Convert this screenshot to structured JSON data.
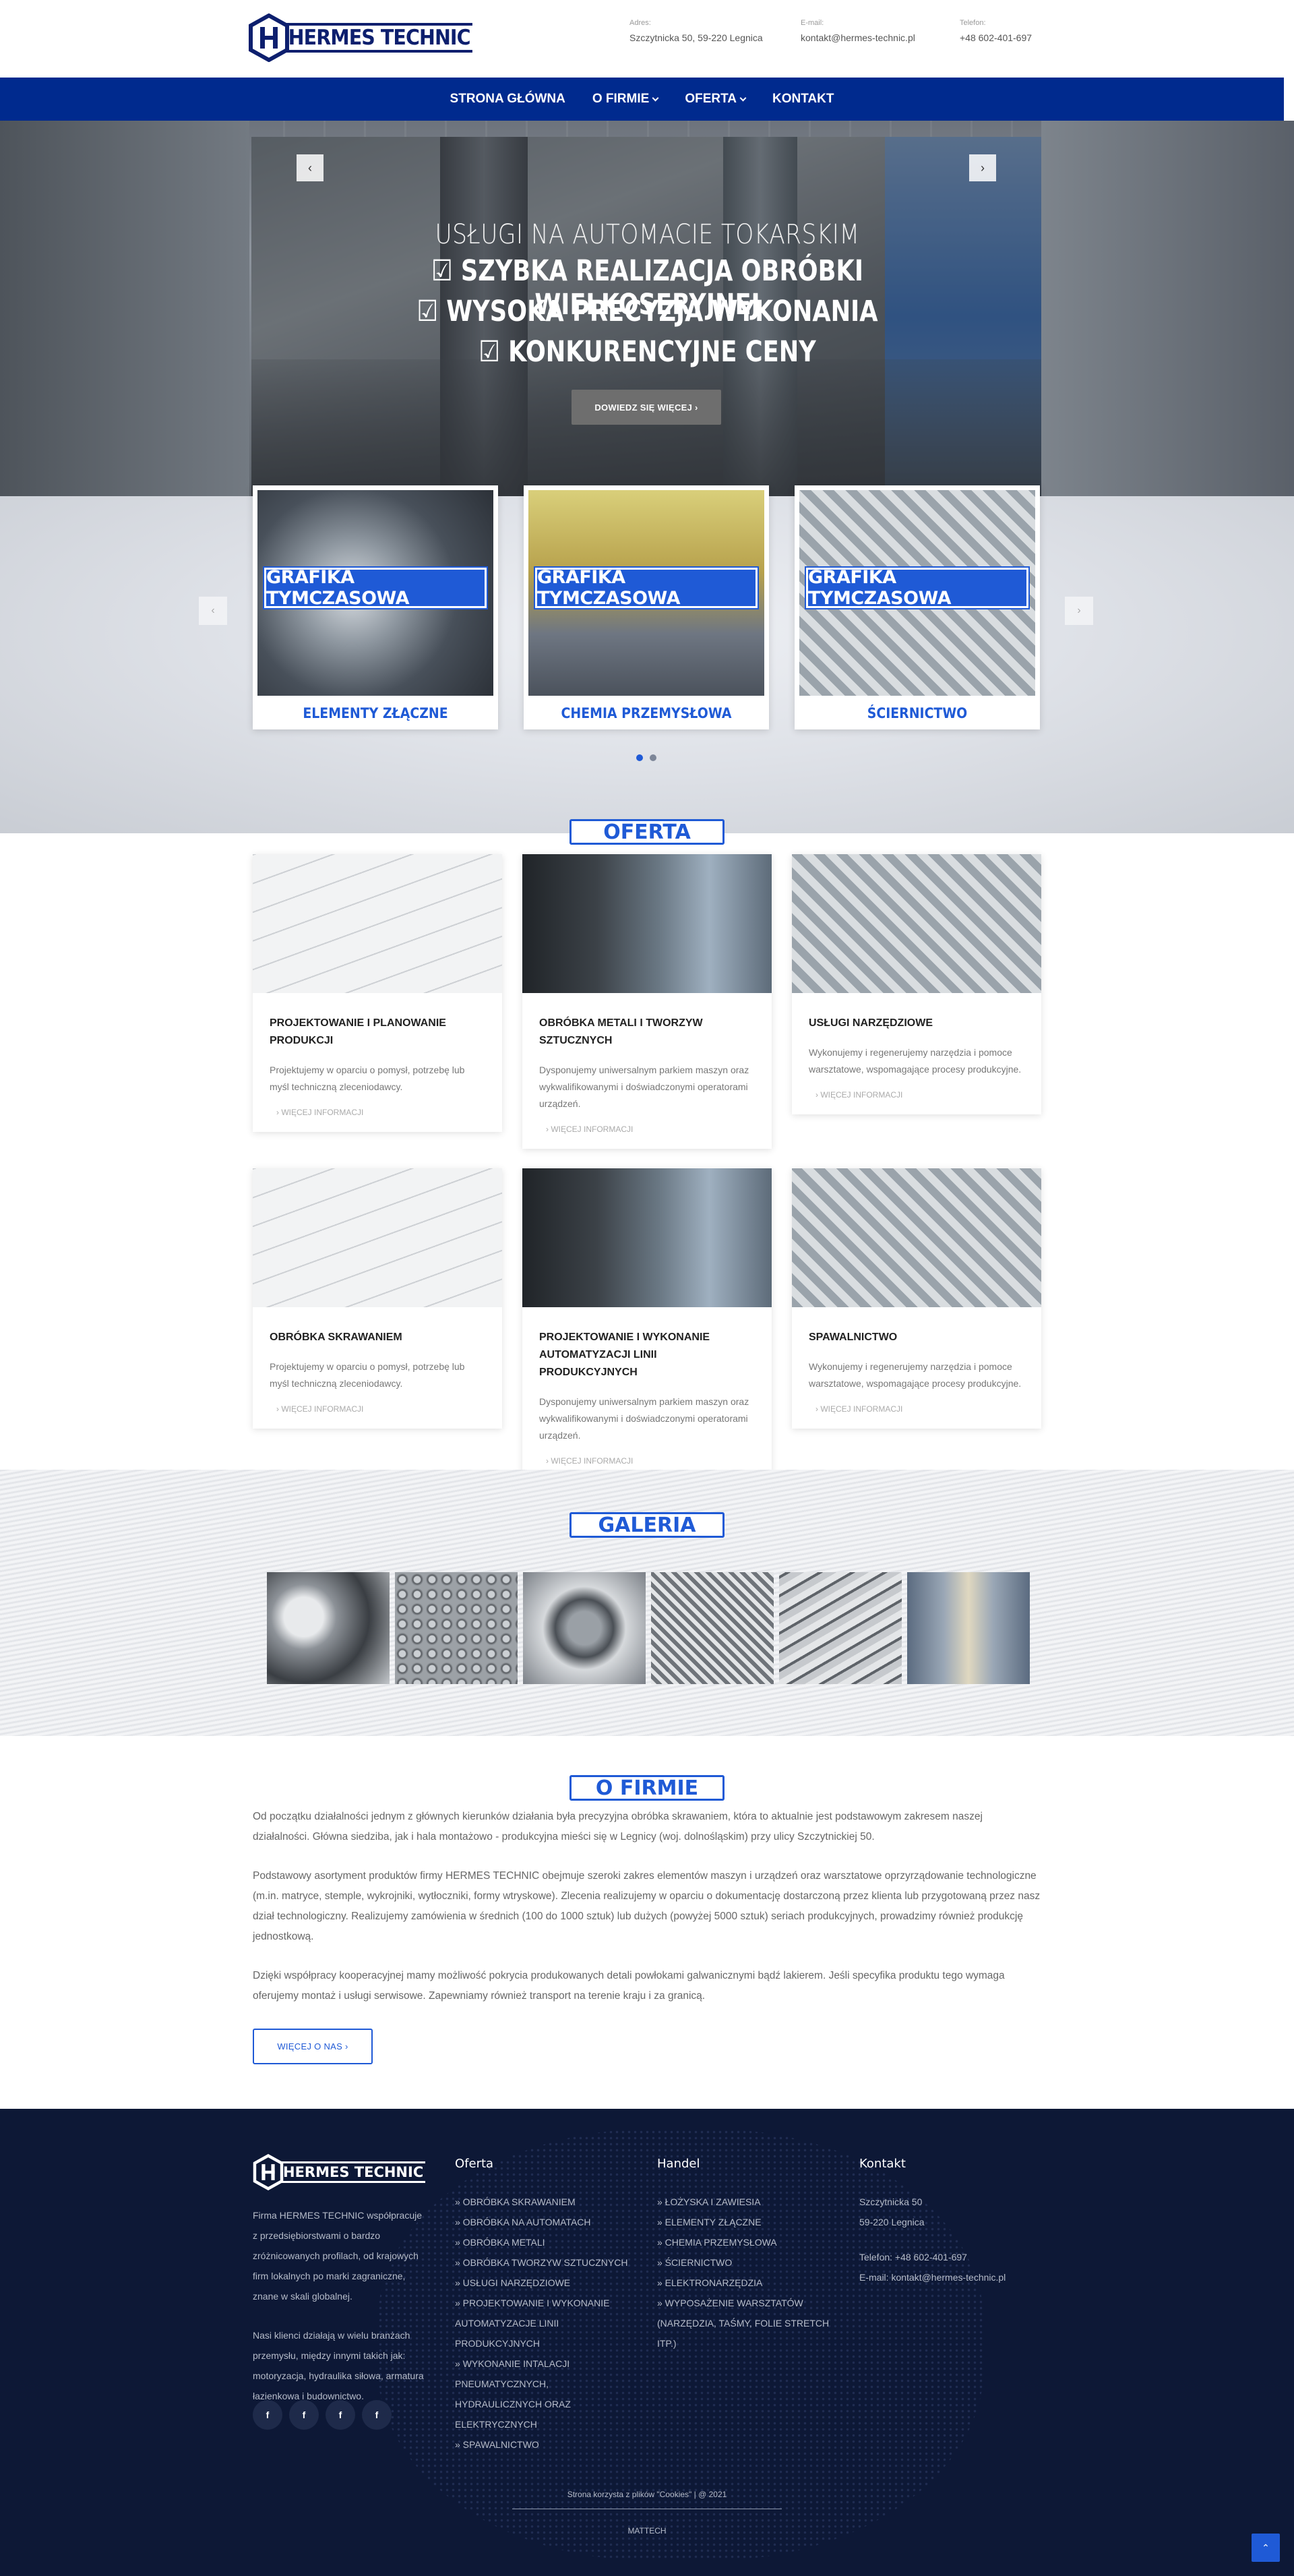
{
  "header": {
    "logo_text": "HERMES TECHNIC",
    "address_label": "Adres:",
    "address": "Szczytnicka 50, 59-220 Legnica",
    "email_label": "E-mail:",
    "email": "kontakt@hermes-technic.pl",
    "phone_label": "Telefon:",
    "phone": "+48 602-401-697"
  },
  "nav": {
    "home": "STRONA GŁÓWNA",
    "about": "O FIRMIE",
    "offer": "OFERTA",
    "contact": "KONTAKT"
  },
  "hero": {
    "subtitle": "USŁUGI NA AUTOMACIE TOKARSKIM",
    "line1": "☑ SZYBKA REALIZACJA OBRÓBKI WIELKOSERYJNEJ",
    "line2": "☑ WYSOKA PRECYZJA WYKONANIA",
    "line3": "☑ KONKURENCYJNE CENY",
    "button": "DOWIEDZ SIĘ WIĘCEJ  ›"
  },
  "categories": [
    {
      "banner": "GRAFIKA TYMCZASOWA",
      "label": "ELEMENTY ZŁĄCZNE"
    },
    {
      "banner": "GRAFIKA TYMCZASOWA",
      "label": "CHEMIA PRZEMYSŁOWA"
    },
    {
      "banner": "GRAFIKA TYMCZASOWA",
      "label": "ŚCIERNICTWO"
    }
  ],
  "offer_title": "OFERTA",
  "offers": [
    {
      "title": "PROJEKTOWANIE I PLANOWANIE PRODUKCJI",
      "desc": "Projektujemy w oparciu o pomysł, potrzebę lub myśl techniczną zleceniodawcy.",
      "more": "›  WIĘCEJ INFORMACJI"
    },
    {
      "title": "OBRÓBKA METALI I TWORZYW SZTUCZNYCH",
      "desc": "Dysponujemy uniwersalnym parkiem maszyn oraz wykwalifikowanymi i doświadczonymi operatorami urządzeń.",
      "more": "›  WIĘCEJ INFORMACJI"
    },
    {
      "title": "USŁUGI NARZĘDZIOWE",
      "desc": "Wykonujemy i regenerujemy narzędzia i pomoce warsztatowe, wspomagające procesy produkcyjne.",
      "more": "›  WIĘCEJ INFORMACJI"
    },
    {
      "title": "OBRÓBKA SKRAWANIEM",
      "desc": "Projektujemy w oparciu o pomysł, potrzebę lub myśl techniczną zleceniodawcy.",
      "more": "›  WIĘCEJ INFORMACJI"
    },
    {
      "title": "PROJEKTOWANIE I WYKONANIE AUTOMATYZACJI LINII PRODUKCYJNYCH",
      "desc": "Dysponujemy uniwersalnym parkiem maszyn oraz wykwalifikowanymi i doświadczonymi operatorami urządzeń.",
      "more": "›  WIĘCEJ INFORMACJI"
    },
    {
      "title": "SPAWALNICTWO",
      "desc": "Wykonujemy i regenerujemy narzędzia i pomoce warsztatowe, wspomagające procesy produkcyjne.",
      "more": "›  WIĘCEJ INFORMACJI"
    }
  ],
  "gallery_title": "GALERIA",
  "about": {
    "title": "O FIRMIE",
    "p1": "Od początku działalności jednym z głównych kierunków działania była precyzyjna obróbka skrawaniem, która to aktualnie jest podstawowym zakresem naszej działalności. Główna siedziba, jak i hala montażowo - produkcyjna mieści się w Legnicy (woj. dolnośląskim) przy ulicy Szczytnickiej 50.",
    "p2": "Podstawowy asortyment produktów firmy HERMES TECHNIC obejmuje szeroki zakres elementów maszyn i urządzeń oraz warsztatowe oprzyrządowanie technologiczne (m.in. matryce, stemple, wykrojniki, wytłoczniki, formy wtryskowe). Zlecenia realizujemy w oparciu o dokumentację dostarczoną przez klienta lub przygotowaną przez nasz dział technologiczny. Realizujemy zamówienia w średnich (100 do 1000 sztuk) lub dużych (powyżej 5000 sztuk) seriach produkcyjnych, prowadzimy również produkcję jednostkową.",
    "p3": "Dzięki współpracy kooperacyjnej mamy możliwość pokrycia produkowanych detali powłokami galwanicznymi bądź lakierem. Jeśli specyfika produktu tego wymaga oferujemy montaż i usługi serwisowe. Zapewniamy również transport na terenie kraju i za granicą.",
    "button": "WIĘCEJ O NAS  ›"
  },
  "footer": {
    "logo_text": "HERMES TECHNIC",
    "about1": "Firma HERMES TECHNIC współpracuje z przedsiębiorstwami o bardzo zróżnicowanych profilach, od krajowych firm lokalnych po marki zagraniczne, znane w skali globalnej.",
    "about2": "Nasi klienci działają w wielu branżach przemysłu, między innymi takich jak: motoryzacja, hydraulika siłowa, armatura łazienkowa i budownictwo.",
    "social": [
      "f",
      "f",
      "f",
      "f"
    ],
    "offer_head": "Oferta",
    "offer_items": [
      "» OBRÓBKA SKRAWANIEM",
      "» OBRÓBKA NA AUTOMATACH",
      "» OBRÓBKA METALI",
      "» OBRÓBKA TWORZYW SZTUCZNYCH",
      "» USŁUGI NARZĘDZIOWE",
      "» PROJEKTOWANIE I WYKONANIE AUTOMATYZACJE LINII PRODUKCYJNYCH",
      "» WYKONANIE INTALACJI PNEUMATYCZNYCH, HYDRAULICZNYCH ORAZ ELEKTRYCZNYCH",
      "» SPAWALNICTWO"
    ],
    "trade_head": "Handel",
    "trade_items": [
      "» ŁOŻYSKA I ZAWIESIA",
      "» ELEMENTY ZŁĄCZNE",
      "» CHEMIA PRZEMYSŁOWA",
      "» ŚCIERNICTWO",
      "» ELEKTRONARZĘDZIA",
      "» WYPOSAŻENIE WARSZTATÓW (NARZĘDZIA, TAŚMY, FOLIE STRETCH ITP.)"
    ],
    "contact_head": "Kontakt",
    "contact_addr1": "Szczytnicka 50",
    "contact_addr2": "59-220 Legnica",
    "contact_phone": "Telefon:  +48 602-401-697",
    "contact_email": "E-mail:  kontakt@hermes-technic.pl",
    "cookies": "Strona korzysta z plików \"Cookies\" | @ 2021",
    "credit": "MATTECH"
  },
  "colors": {
    "brand_blue": "#002a8e",
    "accent": "#1f5ad6",
    "footer_bg": "#0d1836"
  }
}
